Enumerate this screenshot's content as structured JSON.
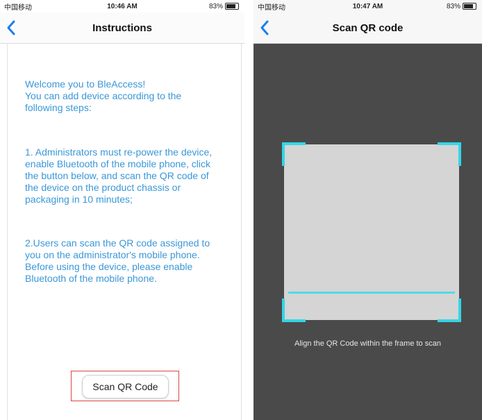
{
  "left": {
    "status": {
      "carrier": "中国移动",
      "time": "10:46 AM",
      "battery": "83%"
    },
    "nav": {
      "title": "Instructions"
    },
    "paragraphs": [
      "Welcome you to BleAccess!\nYou can add device according to the following steps:",
      "1. Administrators must re-power the device, enable Bluetooth of the mobile phone, click the button below, and scan the QR code of the device on the product chassis or packaging in 10 minutes;",
      "2.Users can scan the QR code assigned to you on the administrator's mobile phone. Before using the device, please enable Bluetooth of the mobile phone."
    ],
    "button_label": "Scan QR Code"
  },
  "right": {
    "status": {
      "carrier": "中国移动",
      "time": "10:47 AM",
      "battery": "83%"
    },
    "nav": {
      "title": "Scan QR code"
    },
    "hint": "Align the QR Code within the frame to scan"
  },
  "colors": {
    "text_blue": "#3a97d8",
    "scan_accent": "#33d6e6",
    "camera_bg": "#4a4a4a",
    "highlight_red": "#dd4444"
  },
  "icons": {
    "back": "chevron-left-icon",
    "signal": "signal-icon",
    "wifi": "wifi-icon",
    "alarm": "alarm-icon",
    "battery": "battery-icon"
  }
}
